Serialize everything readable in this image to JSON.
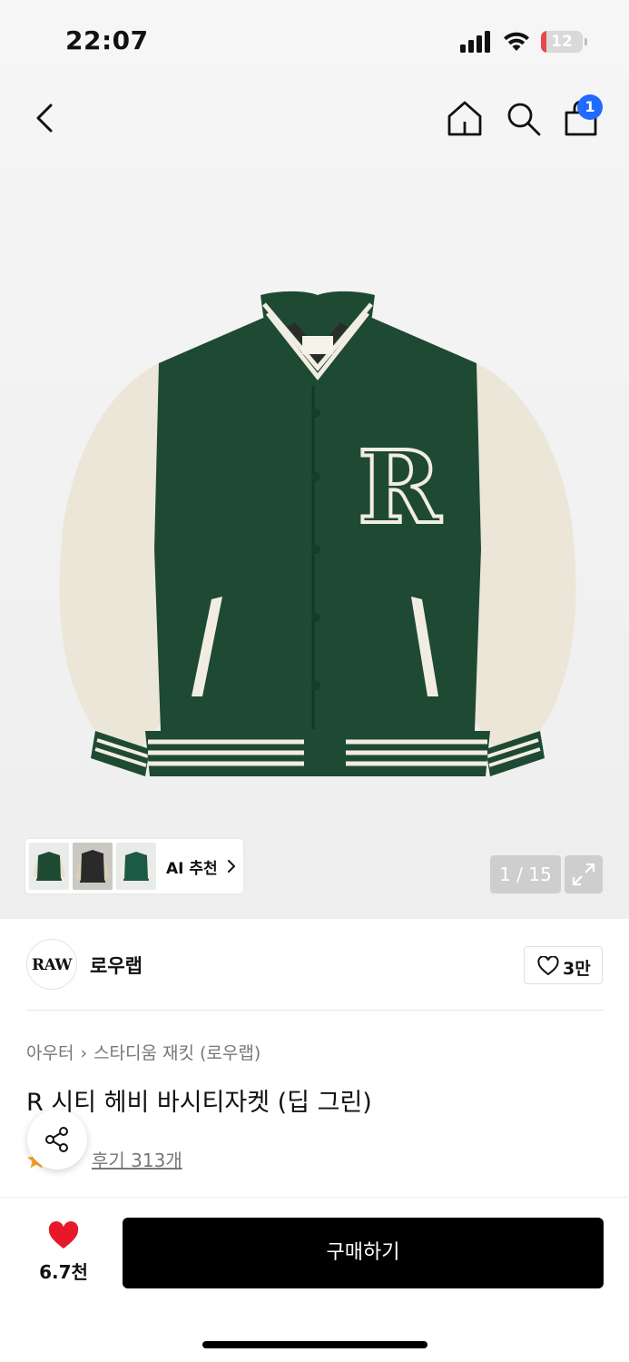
{
  "status_bar": {
    "time": "22:07",
    "battery_level": "12",
    "battery_fraction": 0.12,
    "icons": [
      "signal-icon",
      "wifi-icon",
      "battery-icon"
    ]
  },
  "nav": {
    "back_icon": "chevron-left-icon",
    "home_icon": "home-icon",
    "search_icon": "search-icon",
    "cart_icon": "shopping-bag-icon",
    "cart_badge": "1"
  },
  "gallery": {
    "ai_recommend_label": "AI 추천",
    "page_counter": "1 / 15",
    "expand_icon": "expand-icon",
    "thumbnails": [
      "thumbnail-1",
      "thumbnail-2",
      "thumbnail-3"
    ]
  },
  "brand": {
    "logo_text": "RAW",
    "name": "로우랩",
    "like_count": "3만"
  },
  "product": {
    "breadcrumb": [
      "아우터",
      "스타디움 재킷 (로우랩)"
    ],
    "title": "R 시티 헤비 바시티자켓 (딥 그린)",
    "review_label": "후기 313개"
  },
  "bottom_bar": {
    "favorite_count": "6.7천",
    "buy_label": "구매하기"
  },
  "colors": {
    "accent_blue": "#1f6bff",
    "heart_red": "#e8182b",
    "jacket_green": "#1e4a33",
    "sleeve_cream": "#ece6d8",
    "buy_button": "#000000"
  }
}
